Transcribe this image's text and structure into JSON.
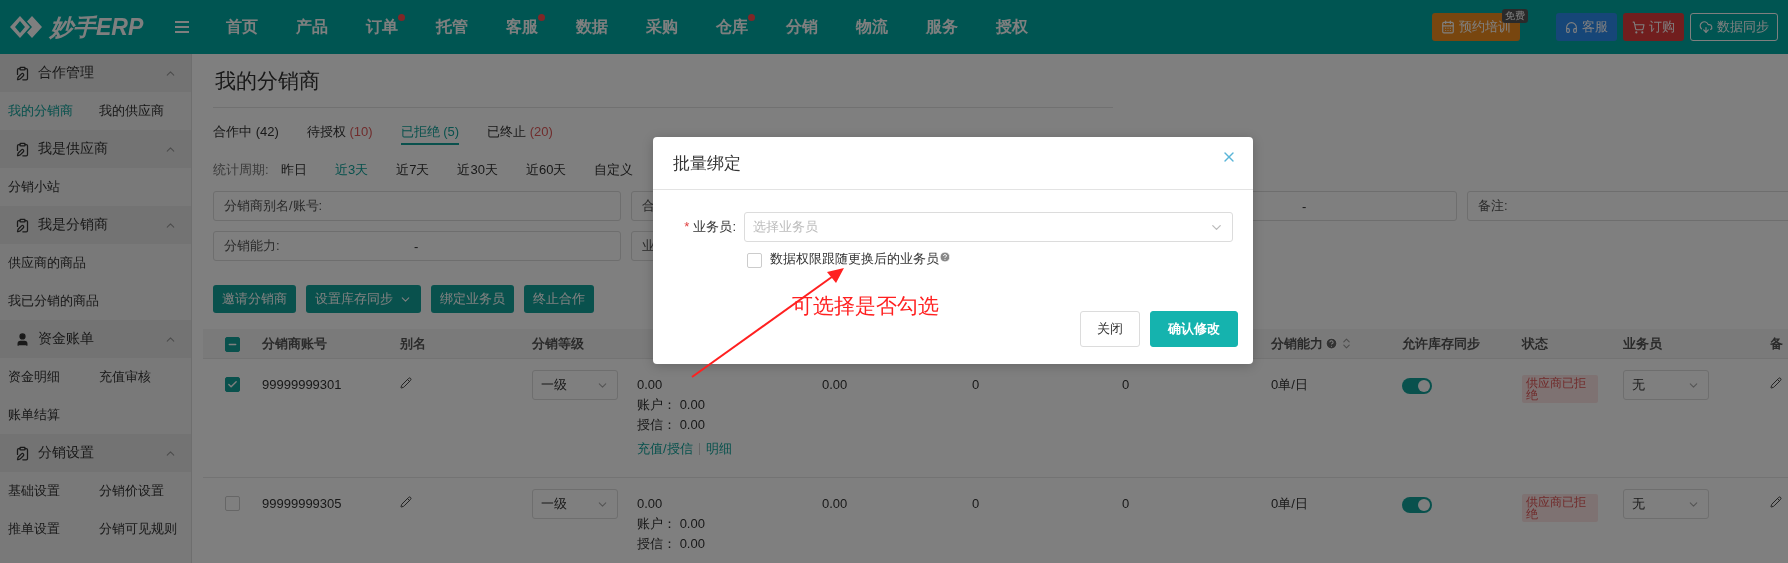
{
  "top_bar": {
    "logo": "妙手ERP",
    "nav": [
      {
        "label": "首页",
        "dot": false
      },
      {
        "label": "产品",
        "dot": false
      },
      {
        "label": "订单",
        "dot": true
      },
      {
        "label": "托管",
        "dot": false
      },
      {
        "label": "客服",
        "dot": true
      },
      {
        "label": "数据",
        "dot": false
      },
      {
        "label": "采购",
        "dot": false
      },
      {
        "label": "仓库",
        "dot": true
      },
      {
        "label": "分销",
        "dot": false
      },
      {
        "label": "物流",
        "dot": false
      },
      {
        "label": "服务",
        "dot": false
      },
      {
        "label": "授权",
        "dot": false
      }
    ],
    "actions": [
      {
        "kind": "training",
        "label": "预约培训",
        "badge": "免费"
      },
      {
        "kind": "service",
        "label": "客服"
      },
      {
        "kind": "order",
        "label": "订购"
      },
      {
        "kind": "sync",
        "label": "数据同步"
      }
    ]
  },
  "sidebar": {
    "sections": [
      {
        "title": "合作管理",
        "expanded": true,
        "rows": [
          [
            {
              "label": "我的分销商",
              "selected": true
            },
            {
              "label": "我的供应商",
              "selected": false
            }
          ]
        ]
      },
      {
        "title": "我是供应商",
        "expanded": true,
        "rows": [
          [
            {
              "label": "分销小站",
              "selected": false
            }
          ]
        ]
      },
      {
        "title": "我是分销商",
        "expanded": true,
        "rows": [
          [
            {
              "label": "供应商的商品",
              "selected": false
            }
          ],
          [
            {
              "label": "我已分销的商品",
              "selected": false
            }
          ]
        ]
      },
      {
        "title": "资金账单",
        "expanded": true,
        "rows": [
          [
            {
              "label": "资金明细",
              "selected": false
            },
            {
              "label": "充值审核",
              "selected": false
            }
          ],
          [
            {
              "label": "账单结算",
              "selected": false
            }
          ]
        ]
      },
      {
        "title": "分销设置",
        "expanded": true,
        "rows": [
          [
            {
              "label": "基础设置",
              "selected": false
            },
            {
              "label": "分销价设置",
              "selected": false
            }
          ],
          [
            {
              "label": "推单设置",
              "selected": false
            },
            {
              "label": "分销可见规则",
              "selected": false
            }
          ]
        ]
      }
    ]
  },
  "page": {
    "title": "我的分销商",
    "tabs": [
      {
        "label": "合作中",
        "count": "(42)",
        "count_highlight": false,
        "selected": false
      },
      {
        "label": "待授权",
        "count": "(10)",
        "count_highlight": true,
        "selected": false
      },
      {
        "label": "已拒绝",
        "count": "(5)",
        "count_highlight": true,
        "selected": true
      },
      {
        "label": "已终止",
        "count": "(20)",
        "count_highlight": true,
        "selected": false
      }
    ],
    "period": {
      "label": "统计周期:",
      "options": [
        {
          "label": "昨日",
          "selected": false
        },
        {
          "label": "近3天",
          "selected": true
        },
        {
          "label": "近7天",
          "selected": false
        },
        {
          "label": "近30天",
          "selected": false
        },
        {
          "label": "近60天",
          "selected": false
        },
        {
          "label": "自定义",
          "selected": false
        }
      ]
    },
    "filters": [
      [
        {
          "label": "分销商别名/账号:"
        },
        {
          "label": "合"
        },
        {
          "value": "-"
        },
        {
          "label": "备注:"
        }
      ],
      [
        {
          "label": "分销能力:",
          "value": "-"
        },
        {
          "label": "业"
        }
      ]
    ],
    "buttons": [
      {
        "label": "邀请分销商",
        "dropdown": false
      },
      {
        "label": "设置库存同步",
        "dropdown": true
      },
      {
        "label": "绑定业务员",
        "dropdown": false
      },
      {
        "label": "终止合作",
        "dropdown": false
      }
    ],
    "table": {
      "header_checkbox": {
        "indeterminate": true
      },
      "columns": [
        {
          "label": "分销商账号"
        },
        {
          "label": "别名"
        },
        {
          "label": "分销等级"
        },
        {
          "label": "分销能力",
          "help": true,
          "sortable": true
        },
        {
          "label": "允许库存同步"
        },
        {
          "label": "状态"
        },
        {
          "label": "业务员"
        },
        {
          "label": "备"
        }
      ],
      "rows": [
        {
          "selected": true,
          "account": "99999999301",
          "level": "一级",
          "column_5": {
            "amount": "0.00",
            "account_label": "账户：",
            "account_value": "0.00",
            "credit_label": "授信：",
            "credit_value": "0.00",
            "links": [
              "充值/授信",
              "明细"
            ]
          },
          "column_6": "0.00",
          "column_7": "0",
          "column_8": "0",
          "capacity": "0单/日",
          "stock_sync": true,
          "status": "供应商已拒绝",
          "salesperson": "无"
        },
        {
          "selected": false,
          "account": "99999999305",
          "level": "一级",
          "column_5": {
            "amount": "0.00",
            "account_label": "账户：",
            "account_value": "0.00",
            "credit_label": "授信：",
            "credit_value": "0.00"
          },
          "column_6": "0.00",
          "column_7": "0",
          "column_8": "0",
          "capacity": "0单/日",
          "stock_sync": true,
          "status": "供应商已拒绝",
          "salesperson": "无"
        }
      ]
    }
  },
  "modal": {
    "title": "批量绑定",
    "field": {
      "required_mark": "*",
      "label": "业务员:",
      "placeholder": "选择业务员"
    },
    "checkbox": {
      "label": "数据权限跟随更换后的业务员",
      "checked": false
    },
    "buttons": [
      {
        "label": "关闭",
        "kind": "secondary"
      },
      {
        "label": "确认修改",
        "kind": "primary"
      }
    ]
  },
  "annotation": {
    "text": "可选择是否勾选"
  }
}
